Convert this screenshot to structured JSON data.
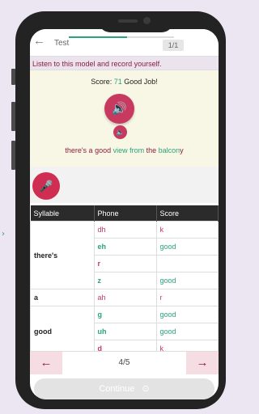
{
  "header": {
    "back_icon": "←",
    "title": "Test",
    "counter": "1/1",
    "progress": 0.55
  },
  "instruction": "Listen to this model and record yourself.",
  "model": {
    "score_prefix": "Score:",
    "score_value": "71",
    "score_text": "Good Job!",
    "play_icon": "🔊",
    "play_slow_icon": "🔈",
    "sentence": [
      {
        "text": "there's ",
        "state": "bad"
      },
      {
        "text": "a ",
        "state": "bad"
      },
      {
        "text": "good ",
        "state": "bad"
      },
      {
        "text": "view ",
        "state": "good"
      },
      {
        "text": "from ",
        "state": "good"
      },
      {
        "text": "the ",
        "state": "bad"
      },
      {
        "text": "balcon",
        "state": "good"
      },
      {
        "text": "y",
        "state": "bad"
      }
    ]
  },
  "record": {
    "mic_icon": "🎤"
  },
  "table": {
    "headers": [
      "Syllable",
      "Phone",
      "Score"
    ],
    "rows": [
      {
        "syllable": "there's",
        "phones": [
          {
            "phone": "dh",
            "score": "k"
          },
          {
            "phone": "eh",
            "score": "good"
          },
          {
            "phone": "r",
            "score": ""
          },
          {
            "phone": "z",
            "score": "good"
          }
        ]
      },
      {
        "syllable": "a",
        "phones": [
          {
            "phone": "ah",
            "score": "r"
          }
        ]
      },
      {
        "syllable": "good",
        "phones": [
          {
            "phone": "g",
            "score": "good"
          },
          {
            "phone": "uh",
            "score": "good"
          },
          {
            "phone": "d",
            "score": "k"
          }
        ]
      }
    ]
  },
  "nav": {
    "prev_icon": "←",
    "label": "4/5",
    "next_icon": "→"
  },
  "continue": {
    "label": "Continue",
    "icon": "⊙"
  },
  "colors": {
    "accent": "#c7395f",
    "good": "#2aa37a",
    "bad": "#8a1f3a"
  }
}
